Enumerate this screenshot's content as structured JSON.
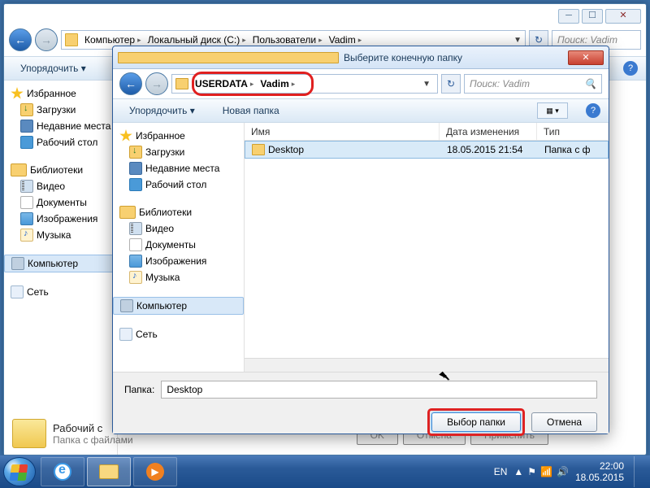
{
  "main_window": {
    "breadcrumbs": [
      "Компьютер",
      "Локальный диск (C:)",
      "Пользователи",
      "Vadim"
    ],
    "search_placeholder": "Поиск: Vadim",
    "toolbar": {
      "organize": "Упорядочить ▾"
    },
    "sidebar": {
      "favorites": {
        "header": "Избранное",
        "items": [
          "Загрузки",
          "Недавние места",
          "Рабочий стол"
        ]
      },
      "libraries": {
        "header": "Библиотеки",
        "items": [
          "Видео",
          "Документы",
          "Изображения",
          "Музыка"
        ]
      },
      "computer": "Компьютер",
      "network": "Сеть"
    },
    "status": {
      "title": "Рабочий с",
      "subtitle": "Папка с файлами"
    },
    "bg_buttons": [
      "OK",
      "Отмена",
      "Применить"
    ]
  },
  "dialog": {
    "title": "Выберите конечную папку",
    "breadcrumbs": [
      "USERDATA",
      "Vadim"
    ],
    "search_placeholder": "Поиск: Vadim",
    "toolbar": {
      "organize": "Упорядочить ▾",
      "new_folder": "Новая папка"
    },
    "sidebar": {
      "favorites": {
        "header": "Избранное",
        "items": [
          "Загрузки",
          "Недавние места",
          "Рабочий стол"
        ]
      },
      "libraries": {
        "header": "Библиотеки",
        "items": [
          "Видео",
          "Документы",
          "Изображения",
          "Музыка"
        ]
      },
      "computer": "Компьютер",
      "network": "Сеть"
    },
    "columns": {
      "name": "Имя",
      "date": "Дата изменения",
      "type": "Тип"
    },
    "rows": [
      {
        "name": "Desktop",
        "date": "18.05.2015 21:54",
        "type": "Папка с ф"
      }
    ],
    "folder_label": "Папка:",
    "folder_value": "Desktop",
    "buttons": {
      "select": "Выбор папки",
      "cancel": "Отмена"
    }
  },
  "taskbar": {
    "lang": "EN",
    "time": "22:00",
    "date": "18.05.2015"
  }
}
